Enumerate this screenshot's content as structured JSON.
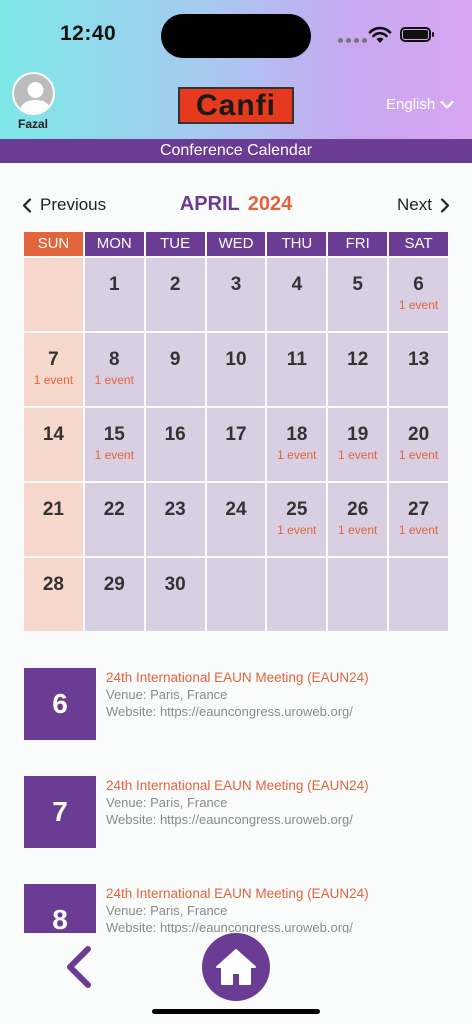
{
  "status": {
    "time": "12:40"
  },
  "header": {
    "user_name": "Fazal",
    "logo_text": "Canfi",
    "language": "English"
  },
  "title_bar": "Conference Calendar",
  "nav": {
    "previous": "Previous",
    "next": "Next",
    "month": "APRIL",
    "year": "2024"
  },
  "calendar": {
    "weekdays": [
      "SUN",
      "MON",
      "TUE",
      "WED",
      "THU",
      "FRI",
      "SAT"
    ],
    "event_label": "1 event",
    "weeks": [
      [
        {
          "d": "",
          "e": ""
        },
        {
          "d": "1",
          "e": ""
        },
        {
          "d": "2",
          "e": ""
        },
        {
          "d": "3",
          "e": ""
        },
        {
          "d": "4",
          "e": ""
        },
        {
          "d": "5",
          "e": ""
        },
        {
          "d": "6",
          "e": "1 event"
        }
      ],
      [
        {
          "d": "7",
          "e": "1 event"
        },
        {
          "d": "8",
          "e": "1 event"
        },
        {
          "d": "9",
          "e": ""
        },
        {
          "d": "10",
          "e": ""
        },
        {
          "d": "11",
          "e": ""
        },
        {
          "d": "12",
          "e": ""
        },
        {
          "d": "13",
          "e": ""
        }
      ],
      [
        {
          "d": "14",
          "e": ""
        },
        {
          "d": "15",
          "e": "1 event"
        },
        {
          "d": "16",
          "e": ""
        },
        {
          "d": "17",
          "e": ""
        },
        {
          "d": "18",
          "e": "1 event"
        },
        {
          "d": "19",
          "e": "1 event"
        },
        {
          "d": "20",
          "e": "1 event"
        }
      ],
      [
        {
          "d": "21",
          "e": ""
        },
        {
          "d": "22",
          "e": ""
        },
        {
          "d": "23",
          "e": ""
        },
        {
          "d": "24",
          "e": ""
        },
        {
          "d": "25",
          "e": "1 event"
        },
        {
          "d": "26",
          "e": "1 event"
        },
        {
          "d": "27",
          "e": "1 event"
        }
      ],
      [
        {
          "d": "28",
          "e": ""
        },
        {
          "d": "29",
          "e": ""
        },
        {
          "d": "30",
          "e": ""
        },
        {
          "d": "",
          "e": ""
        },
        {
          "d": "",
          "e": ""
        },
        {
          "d": "",
          "e": ""
        },
        {
          "d": "",
          "e": ""
        }
      ]
    ]
  },
  "events": [
    {
      "day": "6",
      "title": "24th International EAUN Meeting (EAUN24)",
      "venue": "Venue: Paris, France",
      "website": "Website: https://eauncongress.uroweb.org/"
    },
    {
      "day": "7",
      "title": "24th International EAUN Meeting (EAUN24)",
      "venue": "Venue: Paris, France",
      "website": "Website: https://eauncongress.uroweb.org/"
    },
    {
      "day": "8",
      "title": "24th International EAUN Meeting (EAUN24)",
      "venue": "Venue: Paris, France",
      "website": "Website: https://eauncongress.uroweb.org/"
    }
  ],
  "colors": {
    "primary": "#6a3c93",
    "accent": "#e2643b",
    "weekday_cell": "#d8d0e2",
    "sunday_cell": "#f6d8cc"
  }
}
